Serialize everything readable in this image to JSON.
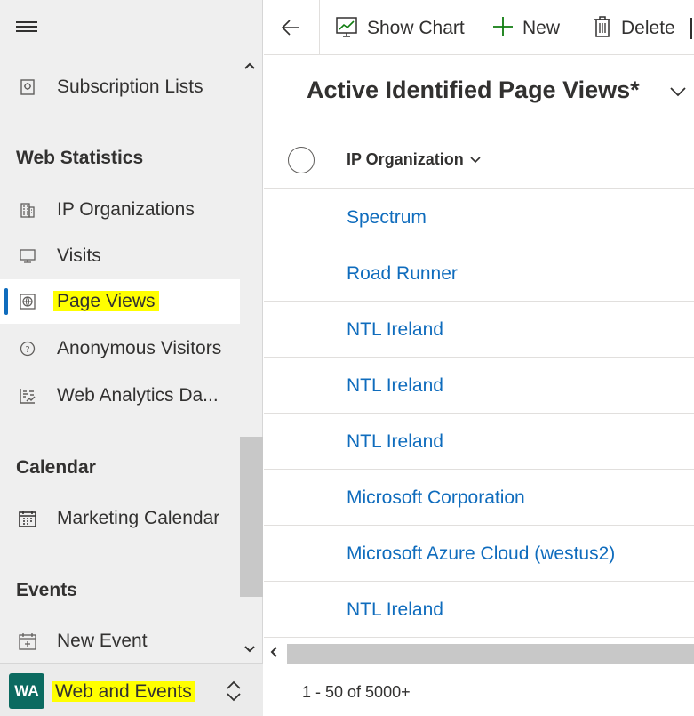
{
  "sidebar": {
    "menu_icon": "hamburger-icon",
    "items_top": [
      {
        "label": "Subscription Lists",
        "icon": "subscription-list-icon"
      }
    ],
    "sections": [
      {
        "title": "Web Statistics",
        "items": [
          {
            "label": "IP Organizations",
            "icon": "building-icon"
          },
          {
            "label": "Visits",
            "icon": "monitor-icon"
          },
          {
            "label": "Page Views",
            "icon": "globe-page-icon",
            "active": true
          },
          {
            "label": "Anonymous Visitors",
            "icon": "question-circle-icon"
          },
          {
            "label": "Web Analytics Da...",
            "icon": "analytics-icon"
          }
        ]
      },
      {
        "title": "Calendar",
        "items": [
          {
            "label": "Marketing Calendar",
            "icon": "calendar-icon"
          }
        ]
      },
      {
        "title": "Events",
        "items": [
          {
            "label": "New Event",
            "icon": "calendar-add-icon"
          }
        ]
      }
    ],
    "area": {
      "badge": "WA",
      "label": "Web and Events",
      "badge_color": "#0b6a60"
    }
  },
  "commandbar": {
    "back_icon": "back-arrow-icon",
    "show_chart": "Show Chart",
    "new": "New",
    "delete": "Delete"
  },
  "view": {
    "title": "Active Identified Page Views*"
  },
  "grid": {
    "column": "IP Organization",
    "rows": [
      "Spectrum",
      "Road Runner",
      "NTL Ireland",
      "NTL Ireland",
      "NTL Ireland",
      "Microsoft Corporation",
      "Microsoft Azure Cloud (westus2)",
      "NTL Ireland"
    ],
    "link_color": "#0f6cbd"
  },
  "footer": {
    "record_count": "1 - 50 of 5000+"
  },
  "colors": {
    "accent": "#0f6cbd",
    "highlight": "#ffff00",
    "new_icon": "#107c10"
  }
}
